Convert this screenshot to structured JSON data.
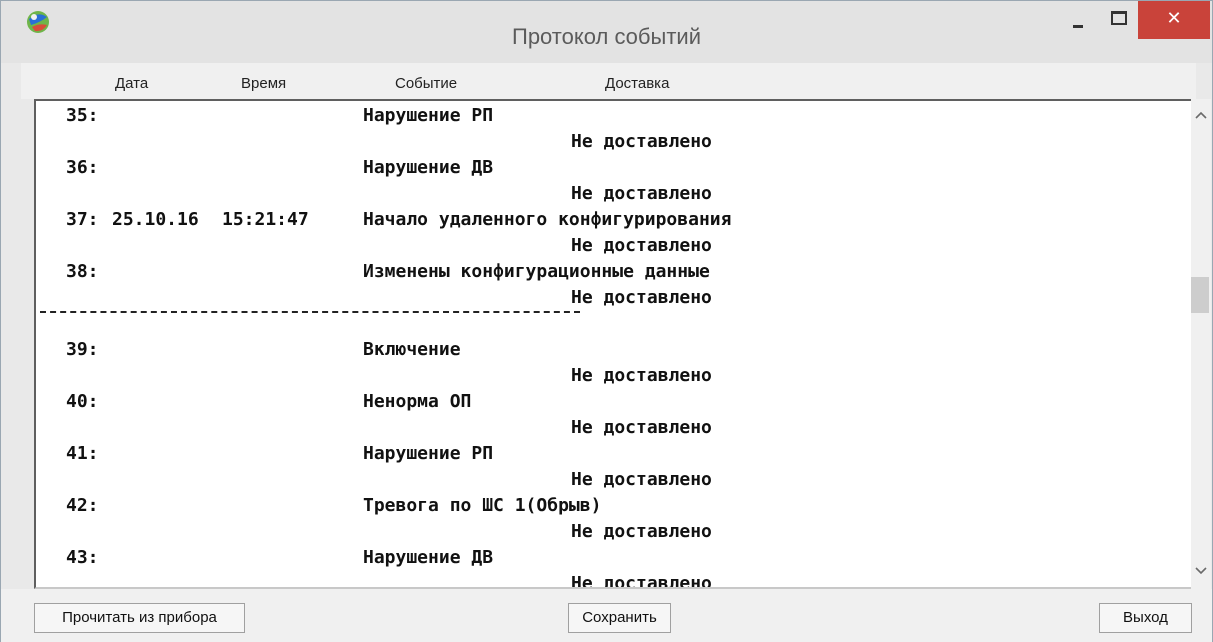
{
  "window": {
    "title": "Протокол событий",
    "close_glyph": "✕",
    "close_color": "#c9433a"
  },
  "columns": {
    "date": "Дата",
    "time": "Время",
    "event": "Событие",
    "delivery": "Доставка"
  },
  "icons": {
    "app": "app-globe-icon",
    "minimize": "minimize-icon",
    "maximize": "maximize-icon",
    "close": "close-icon",
    "scroll_up": "scroll-up-icon",
    "scroll_down": "scroll-down-icon"
  },
  "log": {
    "lines": [
      {
        "num": "35:",
        "date": "",
        "time": "",
        "event": "Нарушение РП",
        "delivery": "Не доставлено"
      },
      {
        "num": "36:",
        "date": "",
        "time": "",
        "event": "Нарушение ДВ",
        "delivery": "Не доставлено"
      },
      {
        "num": "37:",
        "date": "25.10.16",
        "time": "15:21:47",
        "event": "Начало удаленного конфигурирования",
        "delivery": "Не доставлено"
      },
      {
        "num": "38:",
        "date": "",
        "time": "",
        "event": "Изменены конфигурационные данные",
        "delivery": "Не доставлено"
      },
      {
        "num": "39:",
        "date": "",
        "time": "",
        "event": "Включение",
        "delivery": "Не доставлено"
      },
      {
        "num": "40:",
        "date": "",
        "time": "",
        "event": "Ненорма ОП",
        "delivery": "Не доставлено"
      },
      {
        "num": "41:",
        "date": "",
        "time": "",
        "event": "Нарушение РП",
        "delivery": "Не доставлено"
      },
      {
        "num": "42:",
        "date": "",
        "time": "",
        "event": "Тревога по ШС 1(Обрыв)",
        "delivery": "Не доставлено"
      },
      {
        "num": "43:",
        "date": "",
        "time": "",
        "event": "Нарушение ДВ",
        "delivery": "Не доставлено"
      }
    ],
    "separator": "---------------------------------------"
  },
  "buttons": {
    "read": "Прочитать из прибора",
    "save": "Сохранить",
    "exit": "Выход"
  }
}
